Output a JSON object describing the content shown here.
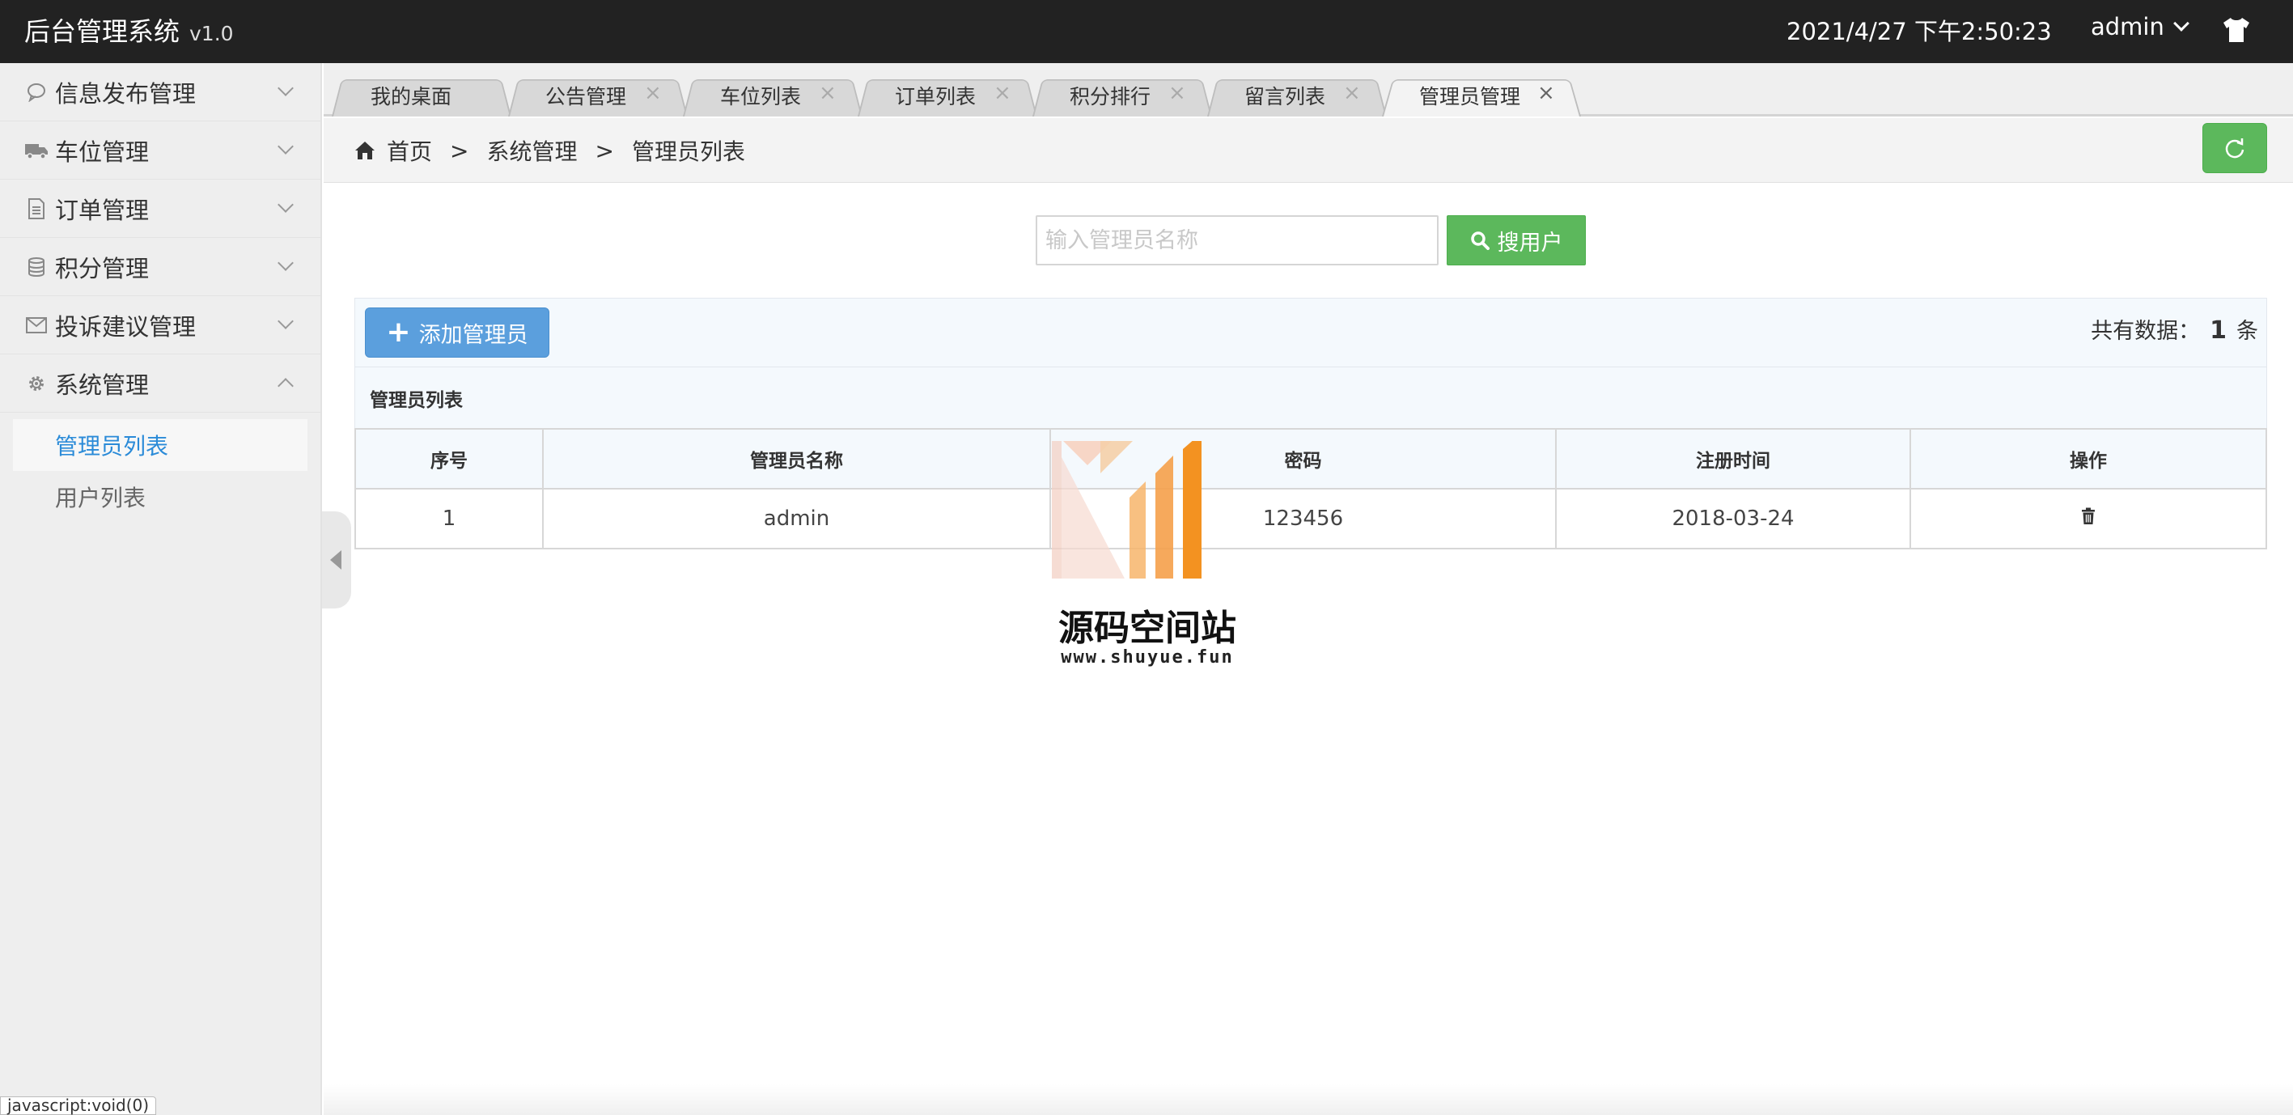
{
  "header": {
    "title": "后台管理系统",
    "version": "v1.0",
    "datetime": "2021/4/27 下午2:50:23",
    "user": "admin"
  },
  "sidebar": {
    "items": [
      {
        "label": "信息发布管理",
        "icon": "chat-icon",
        "expanded": false
      },
      {
        "label": "车位管理",
        "icon": "truck-icon",
        "expanded": false
      },
      {
        "label": "订单管理",
        "icon": "document-icon",
        "expanded": false
      },
      {
        "label": "积分管理",
        "icon": "database-icon",
        "expanded": false
      },
      {
        "label": "投诉建议管理",
        "icon": "envelope-icon",
        "expanded": false
      },
      {
        "label": "系统管理",
        "icon": "gear-icon",
        "expanded": true
      }
    ],
    "subitems": [
      {
        "label": "管理员列表",
        "active": true
      },
      {
        "label": "用户列表",
        "active": false
      }
    ]
  },
  "status_tip": "javascript:void(0)",
  "tabs": [
    {
      "label": "我的桌面",
      "closable": false,
      "active": false
    },
    {
      "label": "公告管理",
      "closable": true,
      "active": false
    },
    {
      "label": "车位列表",
      "closable": true,
      "active": false
    },
    {
      "label": "订单列表",
      "closable": true,
      "active": false
    },
    {
      "label": "积分排行",
      "closable": true,
      "active": false
    },
    {
      "label": "留言列表",
      "closable": true,
      "active": false
    },
    {
      "label": "管理员管理",
      "closable": true,
      "active": true
    }
  ],
  "tab_close_glyph": "×",
  "breadcrumb": {
    "home": "首页",
    "sep": ">",
    "level1": "系统管理",
    "level2": "管理员列表"
  },
  "search": {
    "placeholder": "输入管理员名称",
    "value": "",
    "button": "搜用户"
  },
  "toolbar": {
    "add_label": "添加管理员",
    "total_prefix": "共有数据：",
    "total_count": "1",
    "total_suffix": "条"
  },
  "table": {
    "title": "管理员列表",
    "columns": [
      "序号",
      "管理员名称",
      "密码",
      "注册时间",
      "操作"
    ],
    "rows": [
      {
        "id": "1",
        "name": "admin",
        "password": "123456",
        "registered": "2018-03-24"
      }
    ]
  },
  "watermark": {
    "text": "源码空间站",
    "url": "www.shuyue.fun"
  },
  "colors": {
    "header_bg": "#222222",
    "success": "#5cb85c",
    "primary": "#5b9fdd",
    "active_link": "#2b8bd8",
    "watermark_orange": "#f39221"
  }
}
